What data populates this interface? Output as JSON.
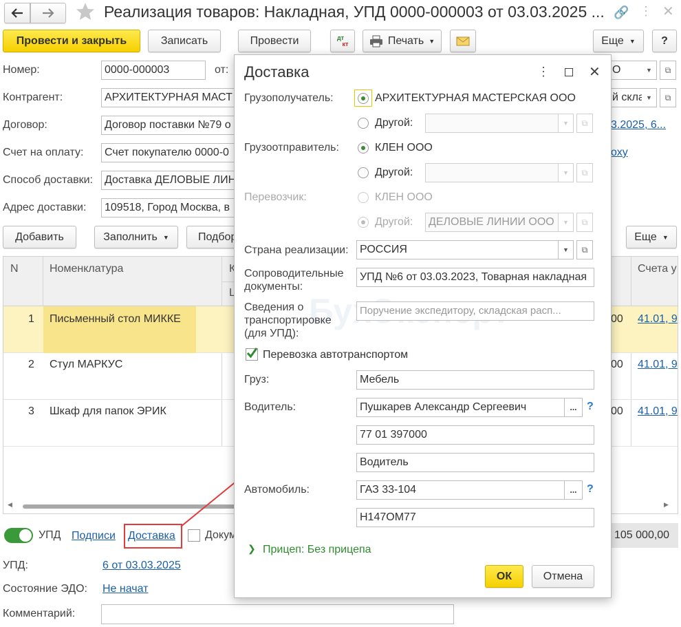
{
  "window": {
    "title": "Реализация товаров: Накладная, УПД 0000-000003 от 03.03.2025 ..."
  },
  "toolbar": {
    "post_close": "Провести и закрыть",
    "save": "Записать",
    "post": "Провести",
    "dtkt_top": "дт",
    "dtkt_bottom": "кт",
    "print": "Печать",
    "more": "Еще",
    "help": "?"
  },
  "form": {
    "number_label": "Номер:",
    "number_value": "0000-000003",
    "from_label": "от:",
    "contractor_label": "Контрагент:",
    "contractor_value": "АРХИТЕКТУРНАЯ МАСТ",
    "contract_label": "Договор:",
    "contract_value": "Договор поставки №79 о",
    "invoice_label": "Счет на оплату:",
    "invoice_value": "Счет покупателю 0000-0",
    "delivery_method_label": "Способ доставки:",
    "delivery_method_value": "Доставка ДЕЛОВЫЕ ЛИН",
    "address_label": "Адрес доставки:",
    "address_value": "109518, Город Москва, в",
    "right_field1": "О",
    "right_field2": "й скла",
    "right_link1": "3.2025, 6...",
    "right_link2": "оху"
  },
  "tabbar": {
    "add": "Добавить",
    "fill": "Заполнить",
    "select": "Подбор",
    "more": "Еще"
  },
  "table": {
    "col_n": "N",
    "col_item": "Номенклатура",
    "col_k": "К",
    "col_l": "L",
    "col_accounts": "Счета у",
    "rows": [
      {
        "n": "1",
        "item": "Письменный стол МИККЕ",
        "tail": "00",
        "account": "41.01, 9"
      },
      {
        "n": "2",
        "item": "Стул МАРКУС",
        "tail": "00",
        "account": "41.01, 9"
      },
      {
        "n": "3",
        "item": "Шкаф для папок ЭРИК",
        "tail": "00",
        "account": "41.01, 9"
      }
    ]
  },
  "footer": {
    "upd_toggle": "УПД",
    "signatures": "Подписи",
    "delivery": "Доставка",
    "doc": "Докум",
    "total": "105 000,00",
    "upd_label": "УПД:",
    "upd_value": "6 от 03.03.2025",
    "edo_label": "Состояние ЭДО:",
    "edo_value": "Не начат",
    "comment_label": "Комментарий:"
  },
  "dialog": {
    "title": "Доставка",
    "consignee_label": "Грузополучатель:",
    "consignee_value": "АРХИТЕКТУРНАЯ МАСТЕРСКАЯ ООО",
    "other_label": "Другой:",
    "shipper_label": "Грузоотправитель:",
    "shipper_value": "КЛЕН ООО",
    "carrier_label": "Перевозчик:",
    "carrier_value": "КЛЕН ООО",
    "carrier_other_value": "ДЕЛОВЫЕ ЛИНИИ ООО",
    "country_label": "Страна реализации:",
    "country_value": "РОССИЯ",
    "docs_label_1": "Сопроводительные",
    "docs_label_2": "документы:",
    "docs_value": "УПД №6 от 03.03.2023, Товарная накладная",
    "transport_label_1": "Сведения о",
    "transport_label_2": "транспортировке",
    "transport_label_3": "(для УПД):",
    "transport_placeholder": "Поручение экспедитору, складская расп...",
    "auto_transport_label": "Перевозка автотранспортом",
    "cargo_label": "Груз:",
    "cargo_value": "Мебель",
    "driver_label": "Водитель:",
    "driver_value": "Пушкарев Александр Сергеевич",
    "driver_license": "77 01 397000",
    "driver_role": "Водитель",
    "vehicle_label": "Автомобиль:",
    "vehicle_value": "ГАЗ 33-104",
    "vehicle_number": "Н147ОМ77",
    "trailer_label": "Прицеп: Без прицепа",
    "ok": "ОК",
    "cancel": "Отмена",
    "dots": "...",
    "question": "?"
  },
  "watermark": "БухЭксперт",
  "colors": {
    "accent_yellow": "#f5d000",
    "link_blue": "#1a5fa8",
    "selected_row": "#fdf3c0",
    "green": "#3a8a3a",
    "highlight_red": "#e23b3b"
  }
}
